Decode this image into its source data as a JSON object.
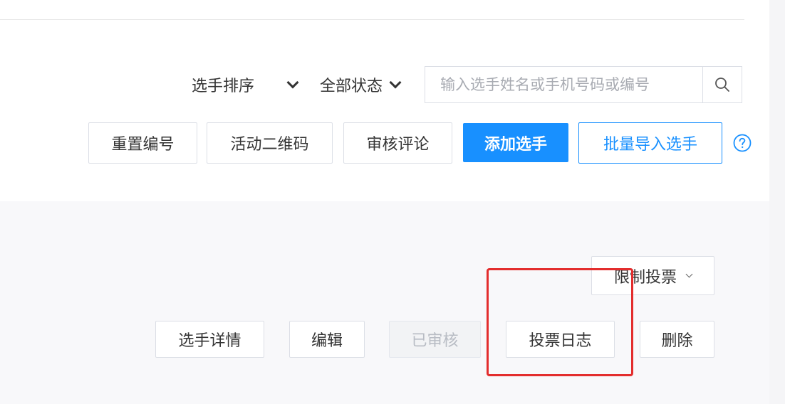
{
  "filters": {
    "sort_label": "选手排序",
    "status_label": "全部状态",
    "search_placeholder": "输入选手姓名或手机号码或编号",
    "search_value": ""
  },
  "toolbar": {
    "reset_number": "重置编号",
    "activity_qr": "活动二维码",
    "review_comments": "审核评论",
    "add_player": "添加选手",
    "batch_import": "批量导入选手"
  },
  "row_actions": {
    "limit_vote": "限制投票",
    "player_detail": "选手详情",
    "edit": "编辑",
    "reviewed": "已审核",
    "vote_log": "投票日志",
    "delete": "删除"
  },
  "colors": {
    "primary": "#1890ff",
    "highlight": "#e32d2d"
  },
  "icons": {
    "search": "search-icon",
    "help": "help-icon"
  }
}
